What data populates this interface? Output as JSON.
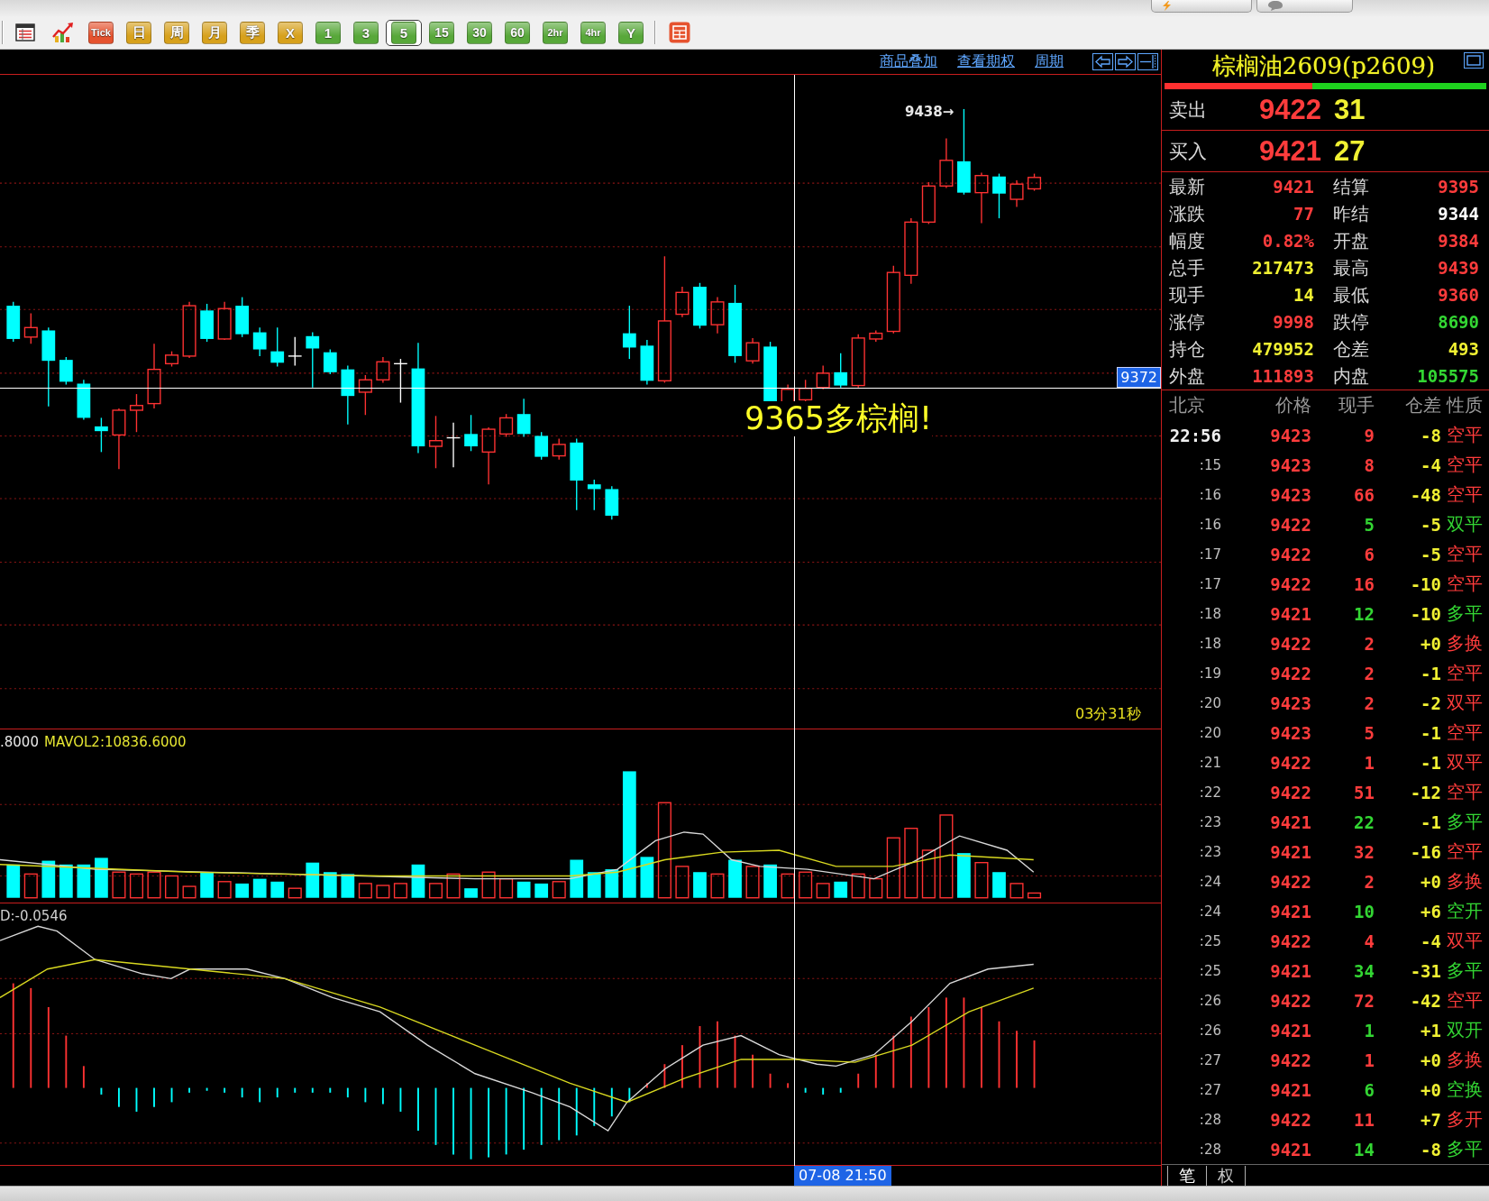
{
  "toolbar": {
    "periods": [
      {
        "label": "Tick",
        "color": "#e5532f",
        "selected": false
      },
      {
        "label": "日",
        "color": "#d7a11c",
        "selected": false
      },
      {
        "label": "周",
        "color": "#d7a11c",
        "selected": false
      },
      {
        "label": "月",
        "color": "#d7a11c",
        "selected": false
      },
      {
        "label": "季",
        "color": "#d7a11c",
        "selected": false
      },
      {
        "label": "X",
        "color": "#d7a11c",
        "selected": false
      },
      {
        "label": "1",
        "color": "#58a83a",
        "selected": false
      },
      {
        "label": "3",
        "color": "#58a83a",
        "selected": false
      },
      {
        "label": "5",
        "color": "#58a83a",
        "selected": true
      },
      {
        "label": "15",
        "color": "#58a83a",
        "selected": false
      },
      {
        "label": "30",
        "color": "#58a83a",
        "selected": false
      },
      {
        "label": "60",
        "color": "#58a83a",
        "selected": false
      },
      {
        "label": "2hr",
        "color": "#58a83a",
        "selected": false
      },
      {
        "label": "4hr",
        "color": "#58a83a",
        "selected": false
      },
      {
        "label": "Y",
        "color": "#58a83a",
        "selected": false
      }
    ]
  },
  "chart": {
    "links": [
      "商品叠加",
      "查看期权",
      "周期"
    ],
    "high_marker": "9438→",
    "annotation": "9365多棕榈!",
    "countdown": "03分31秒",
    "crosshair_price": "9372",
    "crosshair_time": "07-08 21:50"
  },
  "volume_panel": {
    "legend": [
      {
        "text": ".8000",
        "color": "#e8e8e8"
      },
      {
        "text": "MAVOL2:10836.6000",
        "color": "#e6e632"
      }
    ]
  },
  "macd_panel": {
    "legend": [
      {
        "text": "D:-0.0546",
        "color": "#d0d0d0"
      }
    ]
  },
  "quote": {
    "title": "棕榈油2609(p2609)",
    "strength_bar": {
      "level": 0.46
    },
    "book": [
      {
        "label": "卖出",
        "price": "9422",
        "volume": "31"
      },
      {
        "label": "买入",
        "price": "9421",
        "volume": "27"
      }
    ],
    "stats": [
      {
        "label": "最新",
        "value": "9421",
        "color": "#ff3c3c"
      },
      {
        "label": "结算",
        "value": "9395",
        "color": "#ff3c3c"
      },
      {
        "label": "涨跌",
        "value": "77",
        "color": "#ff3c3c"
      },
      {
        "label": "昨结",
        "value": "9344",
        "color": "#ffffff"
      },
      {
        "label": "幅度",
        "value": "0.82%",
        "color": "#ff3c3c"
      },
      {
        "label": "开盘",
        "value": "9384",
        "color": "#ff3c3c"
      },
      {
        "label": "总手",
        "value": "217473",
        "color": "#f0f032"
      },
      {
        "label": "最高",
        "value": "9439",
        "color": "#ff3c3c"
      },
      {
        "label": "现手",
        "value": "14",
        "color": "#f0f032"
      },
      {
        "label": "最低",
        "value": "9360",
        "color": "#ff3c3c"
      },
      {
        "label": "涨停",
        "value": "9998",
        "color": "#ff3c3c"
      },
      {
        "label": "跌停",
        "value": "8690",
        "color": "#33d633"
      },
      {
        "label": "持仓",
        "value": "479952",
        "color": "#f0f032"
      },
      {
        "label": "仓差",
        "value": "493",
        "color": "#f0f032"
      },
      {
        "label": "外盘",
        "value": "111893",
        "color": "#ff3c3c"
      },
      {
        "label": "内盘",
        "value": "105575",
        "color": "#33d633"
      }
    ],
    "ticks": {
      "columns": [
        "北京",
        "价格",
        "现手",
        "仓差",
        "性质"
      ],
      "rows": [
        {
          "time": "22:56",
          "kind": "full",
          "price": "9423",
          "volume": "9",
          "change": "-8",
          "nature": "空平",
          "color": "#ff3c3c"
        },
        {
          "time": ":15",
          "kind": "short",
          "price": "9423",
          "volume": "8",
          "change": "-4",
          "nature": "空平",
          "color": "#ff3c3c"
        },
        {
          "time": ":16",
          "kind": "short",
          "price": "9423",
          "volume": "66",
          "change": "-48",
          "nature": "空平",
          "color": "#ff3c3c"
        },
        {
          "time": ":16",
          "kind": "short",
          "price": "9422",
          "volume": "5",
          "change": "-5",
          "nature": "双平",
          "color": "#33d633"
        },
        {
          "time": ":17",
          "kind": "short",
          "price": "9422",
          "volume": "6",
          "change": "-5",
          "nature": "空平",
          "color": "#ff3c3c"
        },
        {
          "time": ":17",
          "kind": "short",
          "price": "9422",
          "volume": "16",
          "change": "-10",
          "nature": "空平",
          "color": "#ff3c3c"
        },
        {
          "time": ":18",
          "kind": "short",
          "price": "9421",
          "volume": "12",
          "change": "-10",
          "nature": "多平",
          "color": "#33d633"
        },
        {
          "time": ":18",
          "kind": "short",
          "price": "9422",
          "volume": "2",
          "change": "+0",
          "nature": "多换",
          "color": "#ff3c3c"
        },
        {
          "time": ":19",
          "kind": "short",
          "price": "9422",
          "volume": "2",
          "change": "-1",
          "nature": "空平",
          "color": "#ff3c3c"
        },
        {
          "time": ":20",
          "kind": "short",
          "price": "9423",
          "volume": "2",
          "change": "-2",
          "nature": "双平",
          "color": "#ff3c3c"
        },
        {
          "time": ":20",
          "kind": "short",
          "price": "9423",
          "volume": "5",
          "change": "-1",
          "nature": "空平",
          "color": "#ff3c3c"
        },
        {
          "time": ":21",
          "kind": "short",
          "price": "9422",
          "volume": "1",
          "change": "-1",
          "nature": "双平",
          "color": "#ff3c3c"
        },
        {
          "time": ":22",
          "kind": "short",
          "price": "9422",
          "volume": "51",
          "change": "-12",
          "nature": "空平",
          "color": "#ff3c3c"
        },
        {
          "time": ":23",
          "kind": "short",
          "price": "9421",
          "volume": "22",
          "change": "-1",
          "nature": "多平",
          "color": "#33d633"
        },
        {
          "time": ":23",
          "kind": "short",
          "price": "9421",
          "volume": "32",
          "change": "-16",
          "nature": "空平",
          "color": "#ff3c3c"
        },
        {
          "time": ":24",
          "kind": "short",
          "price": "9422",
          "volume": "2",
          "change": "+0",
          "nature": "多换",
          "color": "#ff3c3c"
        },
        {
          "time": ":24",
          "kind": "short",
          "price": "9421",
          "volume": "10",
          "change": "+6",
          "nature": "空开",
          "color": "#33d633"
        },
        {
          "time": ":25",
          "kind": "short",
          "price": "9422",
          "volume": "4",
          "change": "-4",
          "nature": "双平",
          "color": "#ff3c3c"
        },
        {
          "time": ":25",
          "kind": "short",
          "price": "9421",
          "volume": "34",
          "change": "-31",
          "nature": "多平",
          "color": "#33d633"
        },
        {
          "time": ":26",
          "kind": "short",
          "price": "9422",
          "volume": "72",
          "change": "-42",
          "nature": "空平",
          "color": "#ff3c3c"
        },
        {
          "time": ":26",
          "kind": "short",
          "price": "9421",
          "volume": "1",
          "change": "+1",
          "nature": "双开",
          "color": "#33d633"
        },
        {
          "time": ":27",
          "kind": "short",
          "price": "9422",
          "volume": "1",
          "change": "+0",
          "nature": "多换",
          "color": "#ff3c3c"
        },
        {
          "time": ":27",
          "kind": "short",
          "price": "9421",
          "volume": "6",
          "change": "+0",
          "nature": "空换",
          "color": "#33d633"
        },
        {
          "time": ":28",
          "kind": "short",
          "price": "9422",
          "volume": "11",
          "change": "+7",
          "nature": "多开",
          "color": "#ff3c3c"
        },
        {
          "time": ":28",
          "kind": "short",
          "price": "9421",
          "volume": "14",
          "change": "-8",
          "nature": "多平",
          "color": "#33d633"
        }
      ]
    },
    "tabs": [
      {
        "label": "笔",
        "selected": true
      },
      {
        "label": "权",
        "selected": false
      }
    ]
  }
}
